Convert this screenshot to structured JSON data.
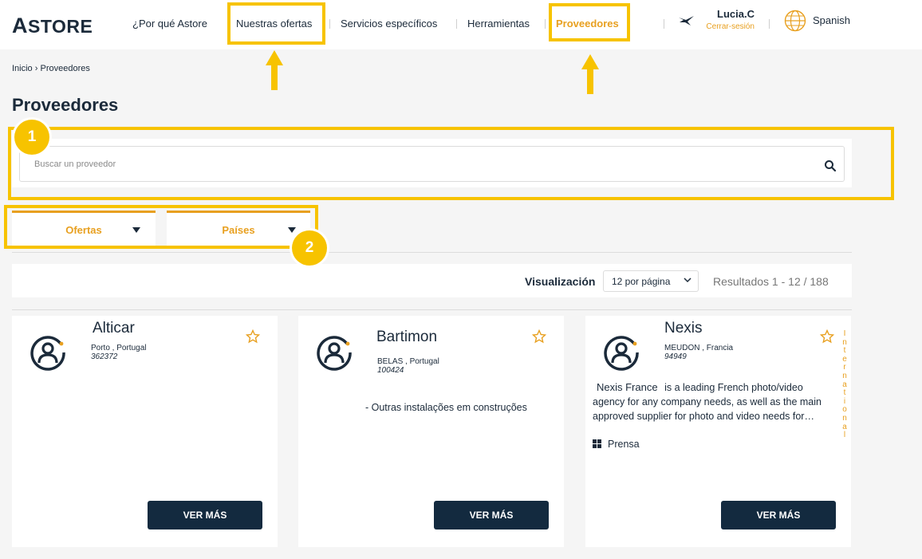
{
  "header": {
    "logo": {
      "first": "A",
      "rest": "STORE"
    },
    "nav": [
      {
        "label": "¿Por qué Astore"
      },
      {
        "label": "Nuestras ofertas"
      },
      {
        "label": "Servicios específicos"
      },
      {
        "label": "Herramientas"
      },
      {
        "label": "Proveedores"
      }
    ],
    "user_name": "Lucia.C",
    "logout_label": "Cerrar-sesión",
    "language": "Spanish"
  },
  "breadcrumb": {
    "home": "Inicio",
    "separator": "›",
    "current": "Proveedores"
  },
  "page_title": "Proveedores",
  "search": {
    "placeholder": "Buscar un proveedor",
    "value": "",
    "icon": "search-icon"
  },
  "filters": [
    {
      "label": "Ofertas"
    },
    {
      "label": "Países"
    }
  ],
  "visualization": {
    "label": "Visualización",
    "per_page": "12 por página",
    "results": "Resultados 1 - 12 / 188"
  },
  "suppliers": [
    {
      "name": "Alticar",
      "location": "Porto , Portugal",
      "code": "362372",
      "button": "VER MÁS"
    },
    {
      "name": "Bartimon",
      "location": "BELAS , Portugal",
      "code": "100424",
      "description": "- Outras instalações em construções",
      "button": "VER MÁS"
    },
    {
      "name": "Nexis",
      "location": "MEUDON , Francia",
      "code": "94949",
      "description_highlight": "Nexis France",
      "description": "is a leading French photo/video agency for any company needs, as well as the main approved supplier for photo and video needs for…",
      "tag": "Prensa",
      "vertical_label": "International",
      "button": "VER MÁS"
    }
  ],
  "annotations": {
    "badges": [
      "1",
      "2"
    ],
    "highlight_color": "#f7c300",
    "accent_color": "#e8a020",
    "button_color": "#132a3f"
  }
}
